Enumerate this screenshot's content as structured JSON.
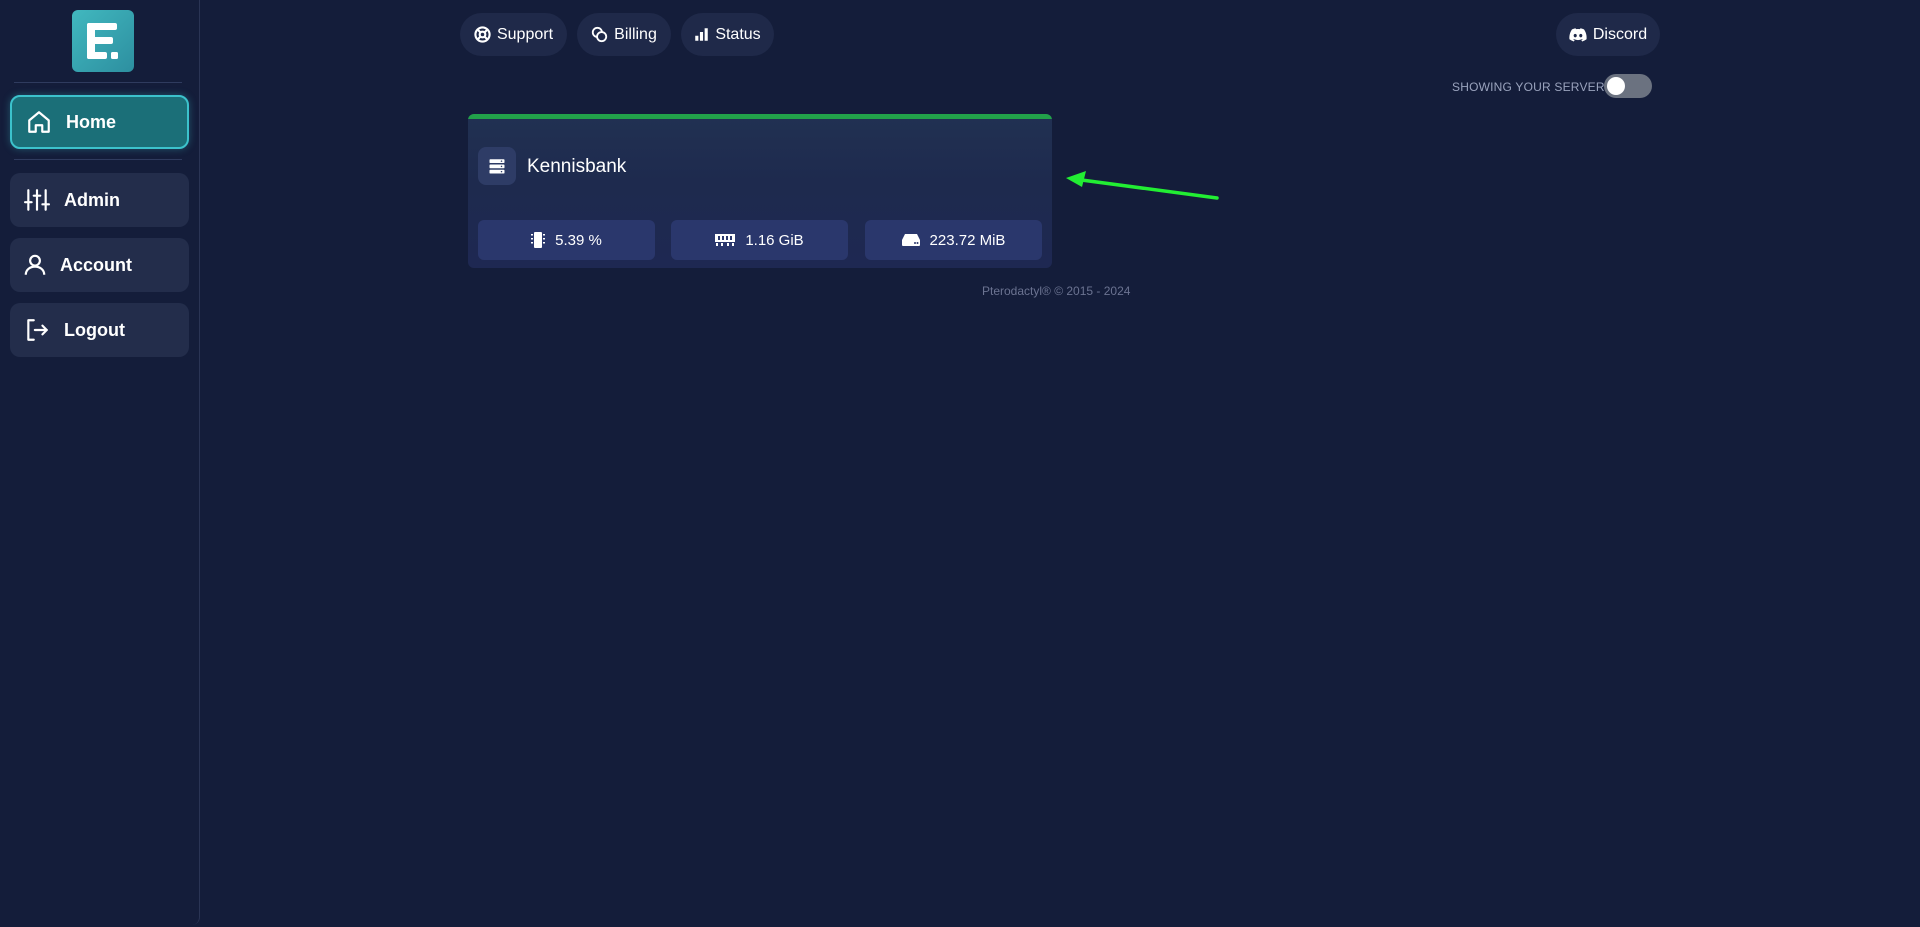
{
  "sidebar": {
    "items": [
      {
        "label": "Home",
        "icon": "home-icon",
        "active": true
      },
      {
        "label": "Admin",
        "icon": "sliders-icon",
        "active": false
      },
      {
        "label": "Account",
        "icon": "user-icon",
        "active": false
      },
      {
        "label": "Logout",
        "icon": "logout-icon",
        "active": false
      }
    ]
  },
  "topnav": {
    "support": "Support",
    "billing": "Billing",
    "status": "Status",
    "discord": "Discord"
  },
  "toggle": {
    "label": "SHOWING YOUR SERVERS",
    "on": false
  },
  "server": {
    "name": "Kennisbank",
    "status_color": "#22a24a",
    "cpu": "5.39 %",
    "memory": "1.16 GiB",
    "disk": "223.72 MiB"
  },
  "footer": {
    "text": "Pterodactyl® © 2015 - 2024"
  },
  "colors": {
    "background": "#141d3a",
    "accent": "#3cc2cc",
    "annotation_arrow": "#22ee33"
  }
}
